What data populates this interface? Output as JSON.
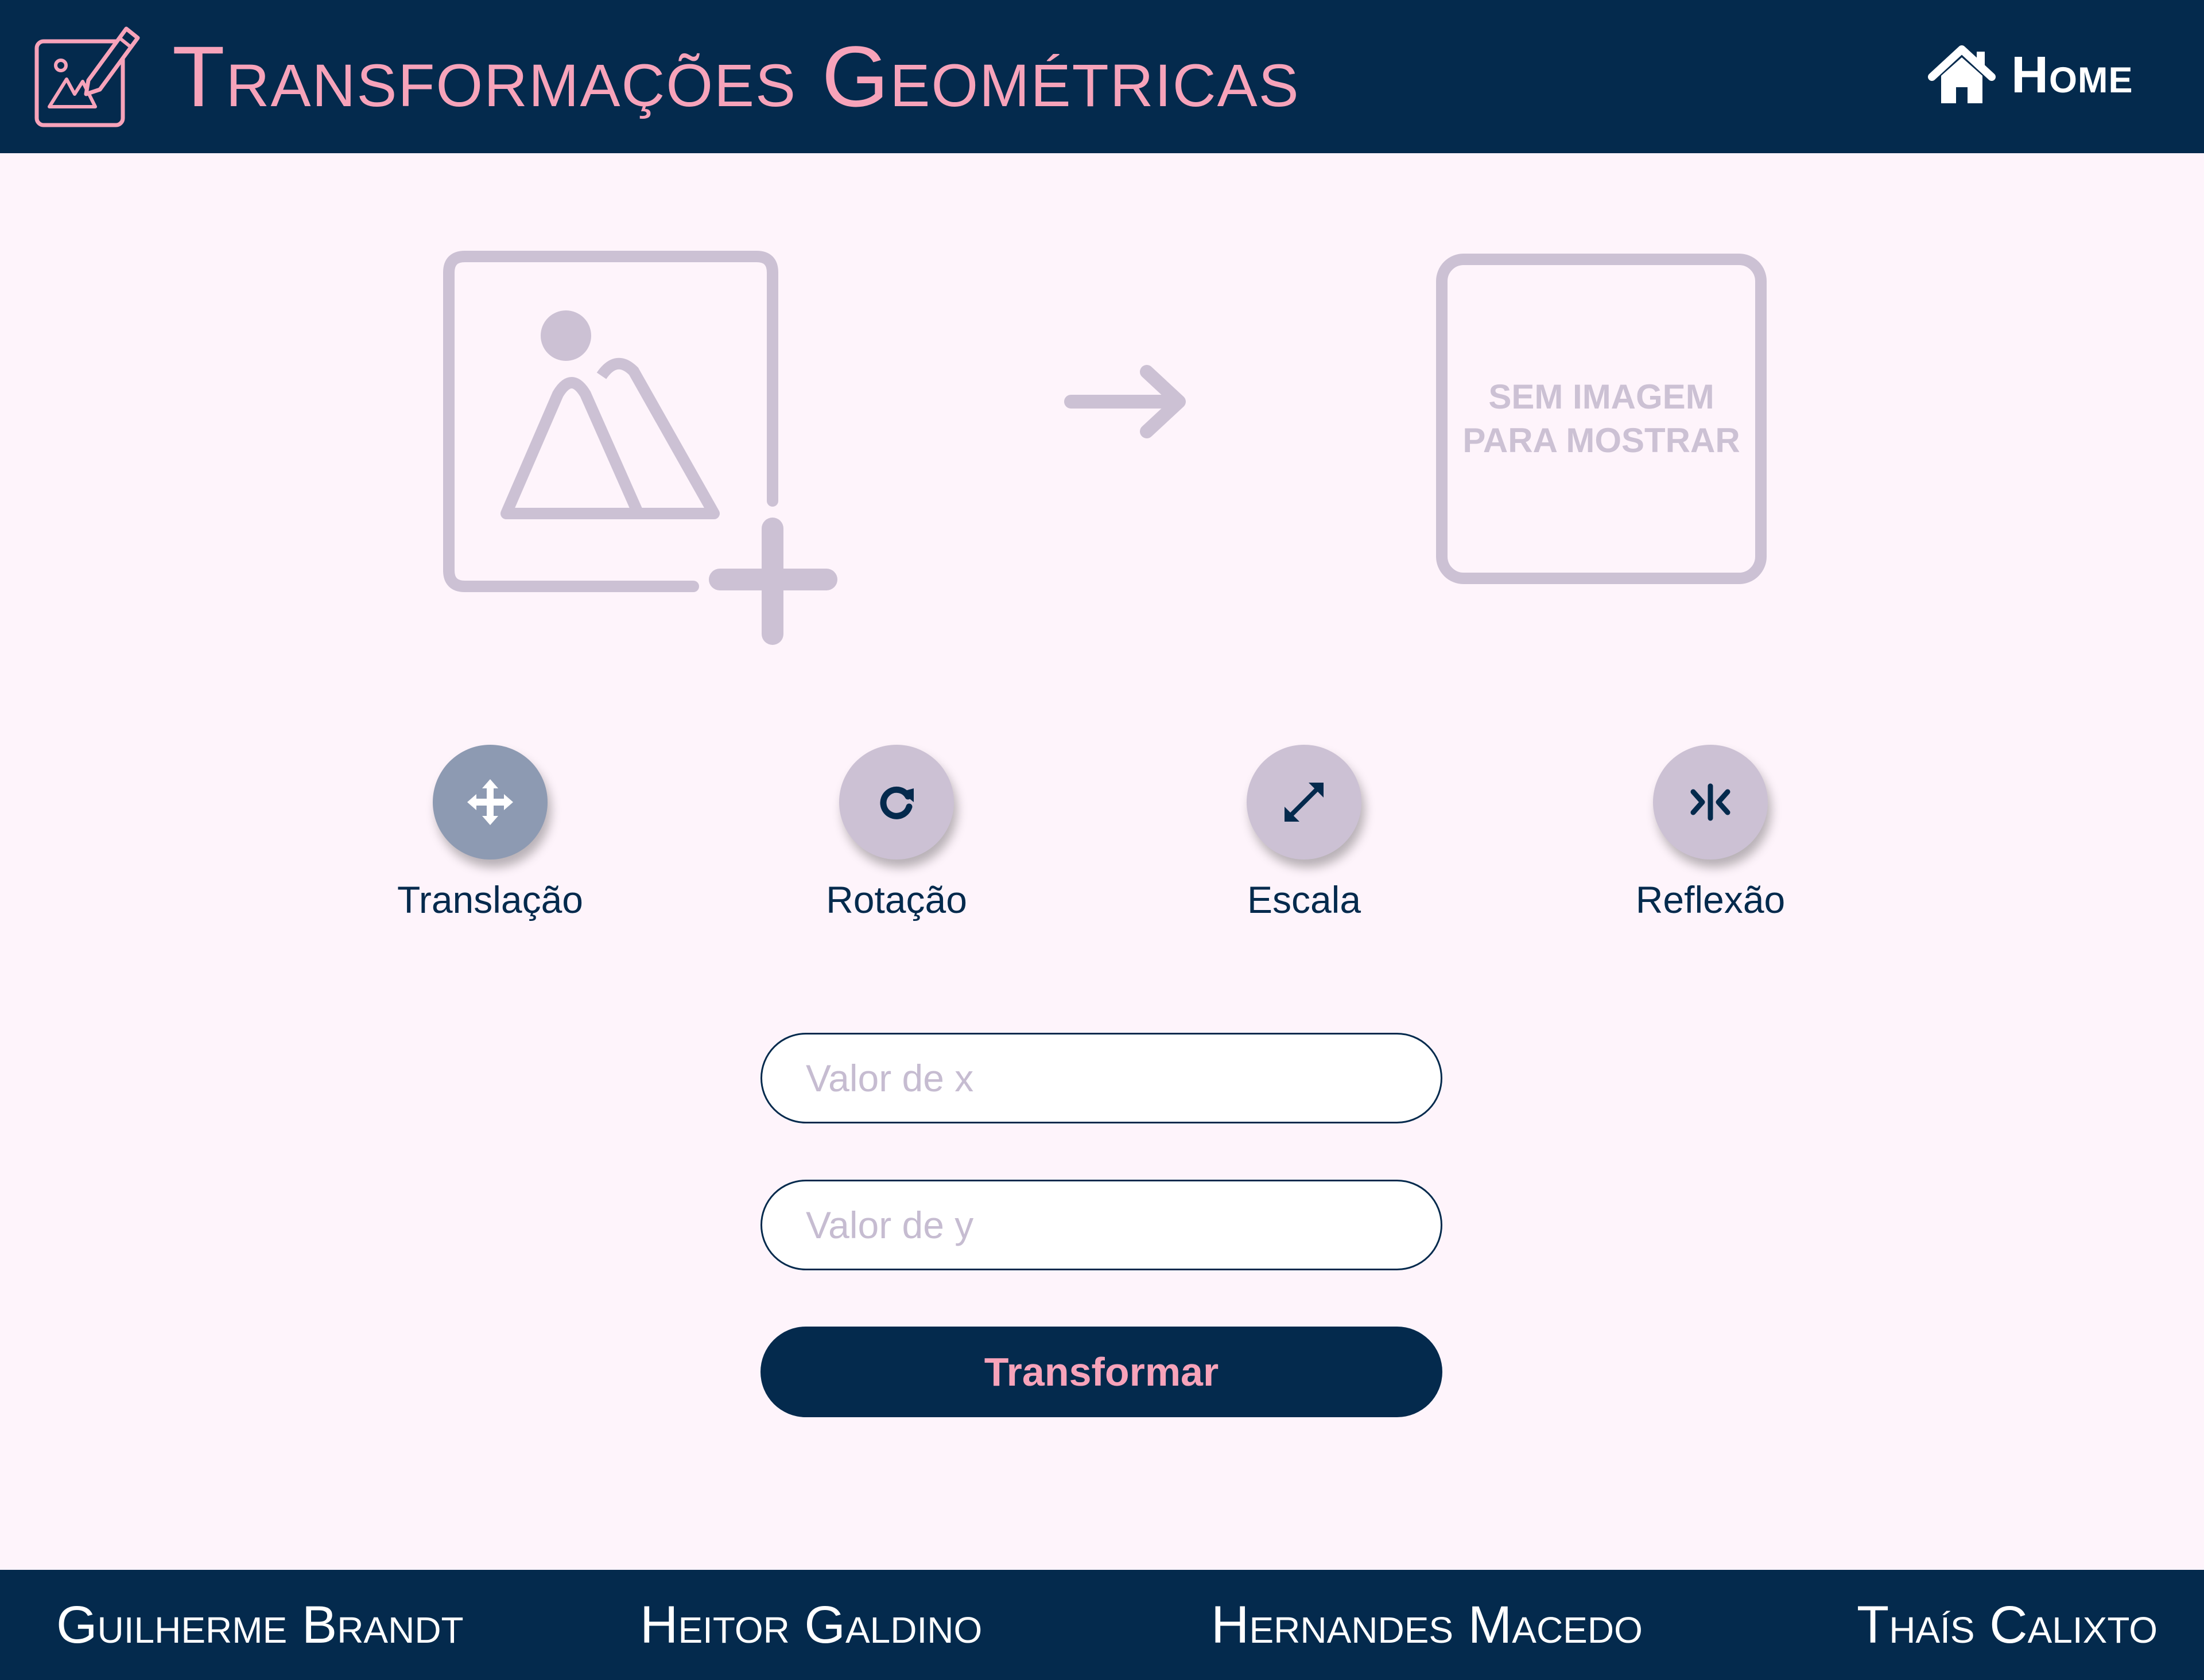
{
  "header": {
    "title": "Transformações Geométricas",
    "logo_icon": "edit-image-icon",
    "home_icon": "home-icon",
    "home_label": "Home"
  },
  "preview": {
    "upload_icon": "add-image-icon",
    "arrow_icon": "arrow-right-icon",
    "empty_text": "SEM IMAGEM PARA MOSTRAR"
  },
  "tools": [
    {
      "label": "Translação",
      "icon": "move-arrows-icon",
      "active": true
    },
    {
      "label": "Rotação",
      "icon": "rotate-icon",
      "active": false
    },
    {
      "label": "Escala",
      "icon": "expand-diagonal-icon",
      "active": false
    },
    {
      "label": "Reflexão",
      "icon": "reflect-icon",
      "active": false
    }
  ],
  "form": {
    "x_placeholder": "Valor de x",
    "x_value": "",
    "y_placeholder": "Valor de y",
    "y_value": "",
    "submit_label": "Transformar"
  },
  "footer": {
    "authors": [
      "Guilherme Brandt",
      "Heitor Galdino",
      "Hernandes Macedo",
      "Thaís Calixto"
    ]
  },
  "colors": {
    "navy": "#042A4D",
    "pink": "#F7A3BA",
    "lilac": "#CCC1D4",
    "active_tool": "#8D9AB2",
    "background": "#FEF4FB"
  }
}
